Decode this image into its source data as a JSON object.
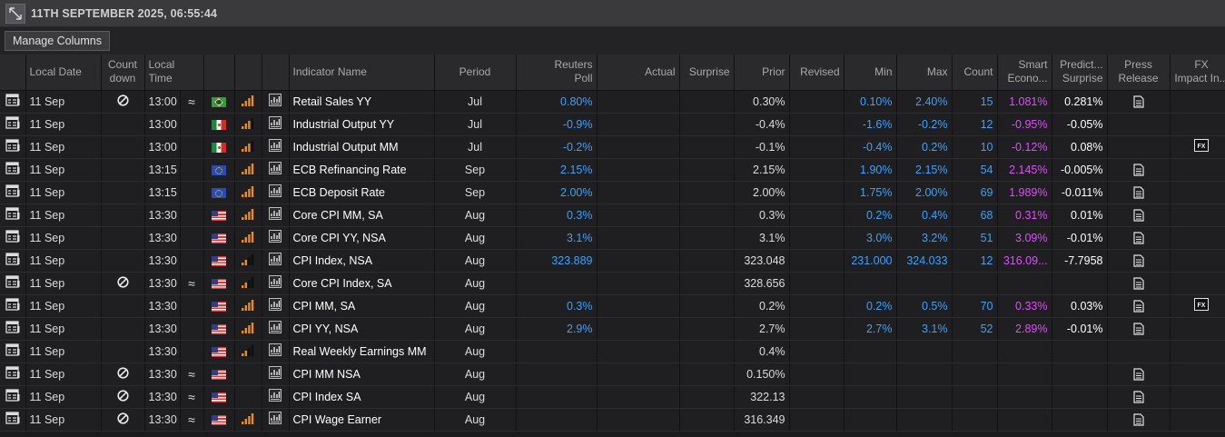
{
  "header": {
    "datetime": "11TH SEPTEMBER 2025, 06:55:44"
  },
  "toolbar": {
    "manage_columns": "Manage Columns"
  },
  "columns": {
    "local_date": "Local Date",
    "countdown_1": "Count",
    "countdown_2": "down",
    "local_time_1": "Local",
    "local_time_2": "Time",
    "indicator_name": "Indicator Name",
    "period": "Period",
    "reuters_poll_1": "Reuters",
    "reuters_poll_2": "Poll",
    "actual": "Actual",
    "surprise": "Surprise",
    "prior": "Prior",
    "revised": "Revised",
    "min": "Min",
    "max": "Max",
    "count": "Count",
    "smart_1": "Smart",
    "smart_2": "Econo...",
    "predict_1": "Predict...",
    "predict_2": "Surprise",
    "press_1": "Press",
    "press_2": "Release",
    "fx_1": "FX",
    "fx_2": "Impact In..."
  },
  "rows": [
    {
      "date": "11 Sep",
      "countdown": true,
      "time": "13:00",
      "approx": true,
      "flag": "br",
      "importance": "high",
      "name": "Retail Sales YY",
      "period": "Jul",
      "poll": "0.80%",
      "actual": "",
      "surprise": "",
      "prior": "0.30%",
      "revised": "",
      "min": "0.10%",
      "max": "2.40%",
      "count": "15",
      "smart": "1.081%",
      "predict": "0.281%",
      "press": true,
      "fx": false
    },
    {
      "date": "11 Sep",
      "countdown": false,
      "time": "13:00",
      "approx": false,
      "flag": "mx",
      "importance": "med",
      "name": "Industrial Output YY",
      "period": "Jul",
      "poll": "-0.9%",
      "actual": "",
      "surprise": "",
      "prior": "-0.4%",
      "revised": "",
      "min": "-1.6%",
      "max": "-0.2%",
      "count": "12",
      "smart": "-0.95%",
      "predict": "-0.05%",
      "press": false,
      "fx": false
    },
    {
      "date": "11 Sep",
      "countdown": false,
      "time": "13:00",
      "approx": false,
      "flag": "mx",
      "importance": "med",
      "name": "Industrial Output MM",
      "period": "Jul",
      "poll": "-0.2%",
      "actual": "",
      "surprise": "",
      "prior": "-0.1%",
      "revised": "",
      "min": "-0.4%",
      "max": "0.2%",
      "count": "10",
      "smart": "-0.12%",
      "predict": "0.08%",
      "press": false,
      "fx": true
    },
    {
      "date": "11 Sep",
      "countdown": false,
      "time": "13:15",
      "approx": false,
      "flag": "eu",
      "importance": "high",
      "name": "ECB Refinancing Rate",
      "period": "Sep",
      "poll": "2.15%",
      "actual": "",
      "surprise": "",
      "prior": "2.15%",
      "revised": "",
      "min": "1.90%",
      "max": "2.15%",
      "count": "54",
      "smart": "2.145%",
      "predict": "-0.005%",
      "press": true,
      "fx": false
    },
    {
      "date": "11 Sep",
      "countdown": false,
      "time": "13:15",
      "approx": false,
      "flag": "eu",
      "importance": "high",
      "name": "ECB Deposit Rate",
      "period": "Sep",
      "poll": "2.00%",
      "actual": "",
      "surprise": "",
      "prior": "2.00%",
      "revised": "",
      "min": "1.75%",
      "max": "2.00%",
      "count": "69",
      "smart": "1.989%",
      "predict": "-0.011%",
      "press": true,
      "fx": false
    },
    {
      "date": "11 Sep",
      "countdown": false,
      "time": "13:30",
      "approx": false,
      "flag": "us",
      "importance": "high",
      "name": "Core CPI MM, SA",
      "period": "Aug",
      "poll": "0.3%",
      "actual": "",
      "surprise": "",
      "prior": "0.3%",
      "revised": "",
      "min": "0.2%",
      "max": "0.4%",
      "count": "68",
      "smart": "0.31%",
      "predict": "0.01%",
      "press": true,
      "fx": false
    },
    {
      "date": "11 Sep",
      "countdown": false,
      "time": "13:30",
      "approx": false,
      "flag": "us",
      "importance": "high",
      "name": "Core CPI YY, NSA",
      "period": "Aug",
      "poll": "3.1%",
      "actual": "",
      "surprise": "",
      "prior": "3.1%",
      "revised": "",
      "min": "3.0%",
      "max": "3.2%",
      "count": "51",
      "smart": "3.09%",
      "predict": "-0.01%",
      "press": true,
      "fx": false
    },
    {
      "date": "11 Sep",
      "countdown": false,
      "time": "13:30",
      "approx": false,
      "flag": "us",
      "importance": "low",
      "name": "CPI Index, NSA",
      "period": "Aug",
      "poll": "323.889",
      "actual": "",
      "surprise": "",
      "prior": "323.048",
      "revised": "",
      "min": "231.000",
      "max": "324.033",
      "count": "12",
      "smart": "316.09...",
      "predict": "-7.7958",
      "press": true,
      "fx": false
    },
    {
      "date": "11 Sep",
      "countdown": true,
      "time": "13:30",
      "approx": true,
      "flag": "us",
      "importance": "low",
      "name": "Core CPI Index, SA",
      "period": "Aug",
      "poll": "",
      "actual": "",
      "surprise": "",
      "prior": "328.656",
      "revised": "",
      "min": "",
      "max": "",
      "count": "",
      "smart": "",
      "predict": "",
      "press": true,
      "fx": false
    },
    {
      "date": "11 Sep",
      "countdown": false,
      "time": "13:30",
      "approx": false,
      "flag": "us",
      "importance": "high",
      "name": "CPI MM, SA",
      "period": "Aug",
      "poll": "0.3%",
      "actual": "",
      "surprise": "",
      "prior": "0.2%",
      "revised": "",
      "min": "0.2%",
      "max": "0.5%",
      "count": "70",
      "smart": "0.33%",
      "predict": "0.03%",
      "press": true,
      "fx": true
    },
    {
      "date": "11 Sep",
      "countdown": false,
      "time": "13:30",
      "approx": false,
      "flag": "us",
      "importance": "high",
      "name": "CPI YY, NSA",
      "period": "Aug",
      "poll": "2.9%",
      "actual": "",
      "surprise": "",
      "prior": "2.7%",
      "revised": "",
      "min": "2.7%",
      "max": "3.1%",
      "count": "52",
      "smart": "2.89%",
      "predict": "-0.01%",
      "press": true,
      "fx": false
    },
    {
      "date": "11 Sep",
      "countdown": false,
      "time": "13:30",
      "approx": false,
      "flag": "us",
      "importance": "low",
      "name": "Real Weekly Earnings MM",
      "period": "Aug",
      "poll": "",
      "actual": "",
      "surprise": "",
      "prior": "0.4%",
      "revised": "",
      "min": "",
      "max": "",
      "count": "",
      "smart": "",
      "predict": "",
      "press": false,
      "fx": false
    },
    {
      "date": "11 Sep",
      "countdown": true,
      "time": "13:30",
      "approx": true,
      "flag": "us",
      "importance": "none",
      "name": "CPI MM NSA",
      "period": "Aug",
      "poll": "",
      "actual": "",
      "surprise": "",
      "prior": "0.150%",
      "revised": "",
      "min": "",
      "max": "",
      "count": "",
      "smart": "",
      "predict": "",
      "press": true,
      "fx": false
    },
    {
      "date": "11 Sep",
      "countdown": true,
      "time": "13:30",
      "approx": true,
      "flag": "us",
      "importance": "none",
      "name": "CPI Index SA",
      "period": "Aug",
      "poll": "",
      "actual": "",
      "surprise": "",
      "prior": "322.13",
      "revised": "",
      "min": "",
      "max": "",
      "count": "",
      "smart": "",
      "predict": "",
      "press": true,
      "fx": false
    },
    {
      "date": "11 Sep",
      "countdown": true,
      "time": "13:30",
      "approx": true,
      "flag": "us",
      "importance": "high",
      "name": "CPI Wage Earner",
      "period": "Aug",
      "poll": "",
      "actual": "",
      "surprise": "",
      "prior": "316.349",
      "revised": "",
      "min": "",
      "max": "",
      "count": "",
      "smart": "",
      "predict": "",
      "press": true,
      "fx": false
    }
  ],
  "colors": {
    "forecast_blue": "#3aa2ff",
    "smart_magenta": "#e04cff",
    "importance_orange": "#f08a1c"
  }
}
